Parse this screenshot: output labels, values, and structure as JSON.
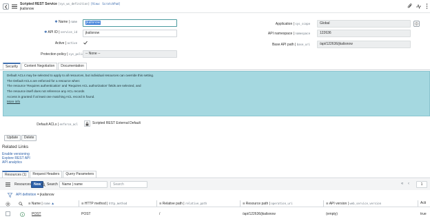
{
  "header": {
    "title": "Scripted REST Service",
    "table_name": "[sys_ws_definition]",
    "view_label": "[View: ScratchPad]",
    "subtitle": "jkalisnow"
  },
  "fields": {
    "name_label": "Name",
    "name_field": "name",
    "name_value": "jkalisnow",
    "api_id_label": "API ID",
    "api_id_field": "service_id",
    "api_id_value": "jkalisnow",
    "active_label": "Active",
    "active_field": "active",
    "protection_label": "Protection policy",
    "protection_field": "sys_policy",
    "protection_value": "-- None --",
    "application_label": "Application",
    "application_field": "sys_scope",
    "application_value": "Global",
    "namespace_label": "API namespace",
    "namespace_field": "namespace",
    "namespace_value": "122636",
    "base_path_label": "Base API path",
    "base_path_field": "base_uri",
    "base_path_value": "/api/122636/jkalisnow"
  },
  "tabs": [
    "Security",
    "Content Negotiation",
    "Documentation"
  ],
  "info_box": {
    "line1": "Default ACLs may be selected to apply to all resources, but individual resources can override this setting.",
    "line2": "The Default ACLs are enforced for a resource when:",
    "line3": "The resource 'Requires authentication' and 'Requires ACL authorization' fields are selected, and",
    "line4": "The resource itself does not reference any ACL records",
    "line5": "Access is granted if at least one matching ACL record is found.",
    "more_info": "More info"
  },
  "default_acls": {
    "label": "Default ACLs",
    "field": "enforce_acl",
    "value": "Scripted REST External Default"
  },
  "buttons": {
    "update": "Update",
    "delete": "Delete"
  },
  "related_links": {
    "heading": "Related Links",
    "items": [
      "Enable versioning",
      "Explore REST API",
      "API analytics"
    ]
  },
  "related_tabs": [
    "Resources (1)",
    "Request Headers",
    "Query Parameters"
  ],
  "list": {
    "title": "Resources",
    "new_label": "New",
    "search_label": "Search",
    "search_field": "Name | name",
    "search_placeholder": "Search",
    "page_number": "1",
    "breadcrumb_root": "API definition",
    "breadcrumb_value": "jkalisnow",
    "columns": [
      {
        "label": "Name",
        "field": "name"
      },
      {
        "label": "HTTP method",
        "field": "http_method"
      },
      {
        "label": "Relative path",
        "field": "relative_path"
      },
      {
        "label": "Resource path",
        "field": "operation_uri"
      },
      {
        "label": "API version",
        "field": "web_service_version"
      },
      {
        "label": "Acti",
        "field": ""
      }
    ],
    "rows": [
      {
        "name": "POST",
        "method": "POST",
        "relative_path": "/",
        "resource_path": "/api/122636/jkalisnow",
        "version": "(empty)",
        "active": "true"
      }
    ]
  },
  "colors": {
    "accent": "#2b5fa8",
    "info_bg": "#a5d8e0",
    "new_button": "#2b5fa8"
  }
}
